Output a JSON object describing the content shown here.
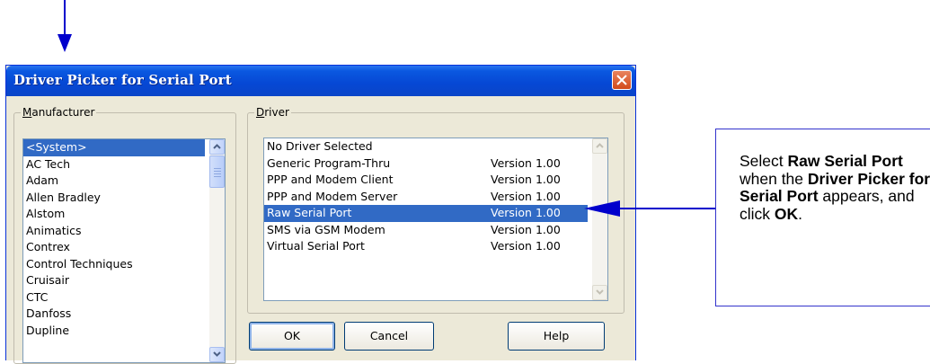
{
  "dialog": {
    "title": "Driver Picker for Serial Port",
    "manufacturer_label": "Manufacturer",
    "driver_label": "Driver",
    "manufacturers": [
      "<System>",
      "AC Tech",
      "Adam",
      "Allen Bradley",
      "Alstom",
      "Animatics",
      "Contrex",
      "Control Techniques",
      "Cruisair",
      "CTC",
      "Danfoss",
      "Dupline"
    ],
    "selected_manufacturer": "<System>",
    "drivers": [
      {
        "name": "No Driver Selected",
        "version": ""
      },
      {
        "name": "Generic Program-Thru",
        "version": "Version 1.00"
      },
      {
        "name": "PPP and Modem Client",
        "version": "Version 1.00"
      },
      {
        "name": "PPP and Modem Server",
        "version": "Version 1.00"
      },
      {
        "name": "Raw Serial Port",
        "version": "Version 1.00"
      },
      {
        "name": "SMS via GSM Modem",
        "version": "Version 1.00"
      },
      {
        "name": "Virtual Serial Port",
        "version": "Version 1.00"
      }
    ],
    "selected_driver": "Raw Serial Port",
    "buttons": {
      "ok": "OK",
      "cancel": "Cancel",
      "help": "Help"
    }
  },
  "callout": {
    "t1": "Select ",
    "b1": "Raw Serial Port",
    "t2": " when the ",
    "b2": "Driver Picker for Serial Port",
    "t3": " appears, and click ",
    "b3": "OK",
    "t4": "."
  },
  "icons": {
    "close": "close-icon",
    "scroll_up": "scroll-up-arrow-icon",
    "scroll_down": "scroll-down-arrow-icon",
    "pointer_arrow": "arrow-down-icon",
    "connector_arrow": "arrow-left-icon"
  },
  "colors": {
    "title_bar": "#0a58e0",
    "selection": "#316ac5",
    "close_button": "#d24a1a",
    "annotation": "#0000cc"
  }
}
